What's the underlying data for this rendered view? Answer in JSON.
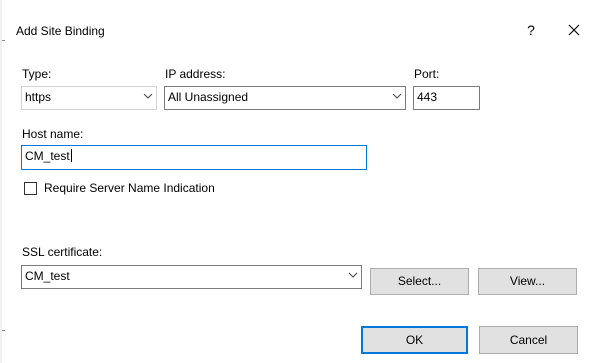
{
  "dialog": {
    "title": "Add Site Binding",
    "help_glyph": "?"
  },
  "type": {
    "label": "Type:",
    "value": "https"
  },
  "ip_address": {
    "label": "IP address:",
    "value": "All Unassigned"
  },
  "port": {
    "label": "Port:",
    "value": "443"
  },
  "host_name": {
    "label": "Host name:",
    "value": "CM_test"
  },
  "sni": {
    "label": "Require Server Name Indication",
    "checked": false
  },
  "ssl_certificate": {
    "label": "SSL certificate:",
    "value": "CM_test"
  },
  "buttons": {
    "select": "Select...",
    "view": "View...",
    "ok": "OK",
    "cancel": "Cancel"
  },
  "icons": {
    "close": "close-x-icon",
    "dropdown": "chevron-down-icon"
  },
  "colors": {
    "focus_border": "#0078d7",
    "button_face": "#e1e1e1"
  }
}
